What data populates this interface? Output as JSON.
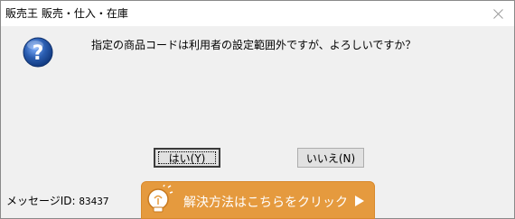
{
  "window": {
    "title": "販売王 販売・仕入・在庫"
  },
  "message": {
    "text": "指定の商品コードは利用者の設定範囲外ですが、よろしいですか？"
  },
  "buttons": {
    "yes_label": "はい(Y)",
    "no_label": "いいえ(N)"
  },
  "footer": {
    "message_id_label": "メッセージID:",
    "message_id_value": "83437",
    "help_text": "解決方法はこちらをクリック"
  },
  "colors": {
    "accent": "#e59a3e",
    "question_icon": "#2a5db0"
  },
  "icons": {
    "close": "close-icon",
    "question": "question-icon",
    "bulb": "lightbulb-icon",
    "arrow": "arrow-right-icon"
  }
}
